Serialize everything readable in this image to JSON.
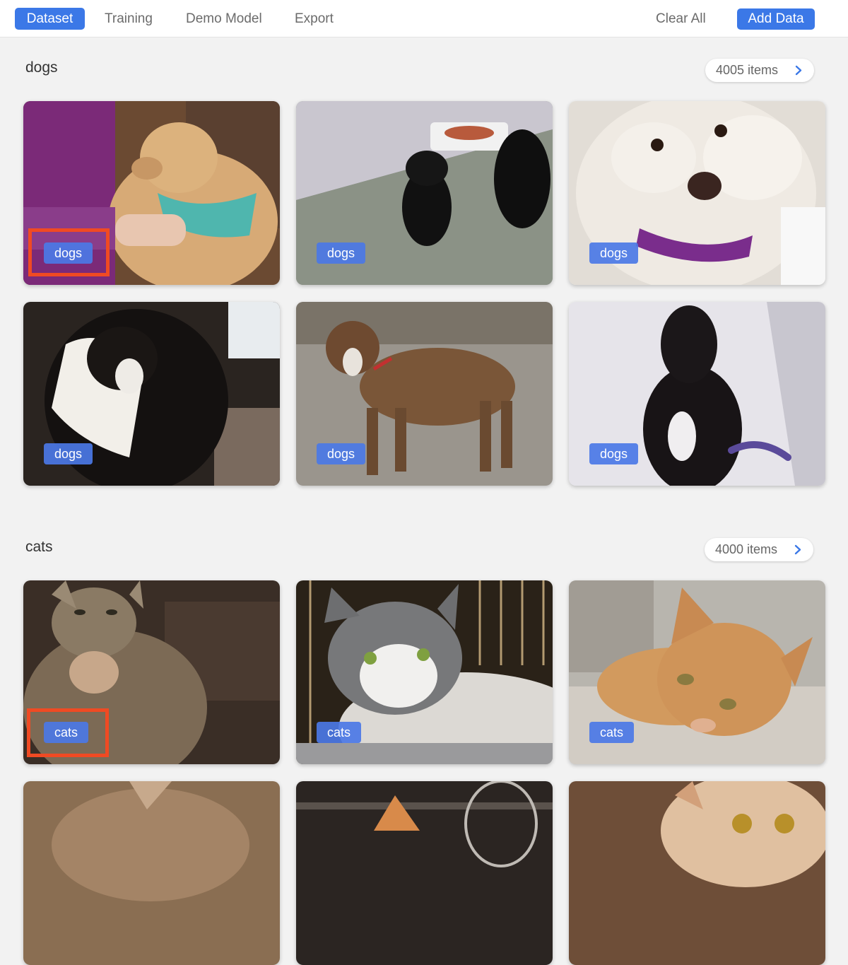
{
  "nav": {
    "tabs": [
      {
        "label": "Dataset",
        "active": true
      },
      {
        "label": "Training",
        "active": false
      },
      {
        "label": "Demo Model",
        "active": false
      },
      {
        "label": "Export",
        "active": false
      }
    ],
    "clear_all": "Clear All",
    "add_data": "Add Data"
  },
  "sections": [
    {
      "name": "dogs",
      "count_label": "4005 items",
      "cards": [
        {
          "label": "dogs",
          "subject": "tan dog with teal bandana"
        },
        {
          "label": "dogs",
          "subject": "black puppy in room"
        },
        {
          "label": "dogs",
          "subject": "white poodle"
        },
        {
          "label": "dogs",
          "subject": "black and white border collie"
        },
        {
          "label": "dogs",
          "subject": "brindle dog on gravel"
        },
        {
          "label": "dogs",
          "subject": "black dog sitting"
        }
      ]
    },
    {
      "name": "cats",
      "count_label": "4000 items",
      "cards": [
        {
          "label": "cats",
          "subject": "tabby cat"
        },
        {
          "label": "cats",
          "subject": "grey and white cat"
        },
        {
          "label": "cats",
          "subject": "orange tabby cat"
        }
      ]
    }
  ],
  "colors": {
    "accent": "#3b78e7",
    "highlight": "#f04a23",
    "background": "#f2f2f2"
  }
}
